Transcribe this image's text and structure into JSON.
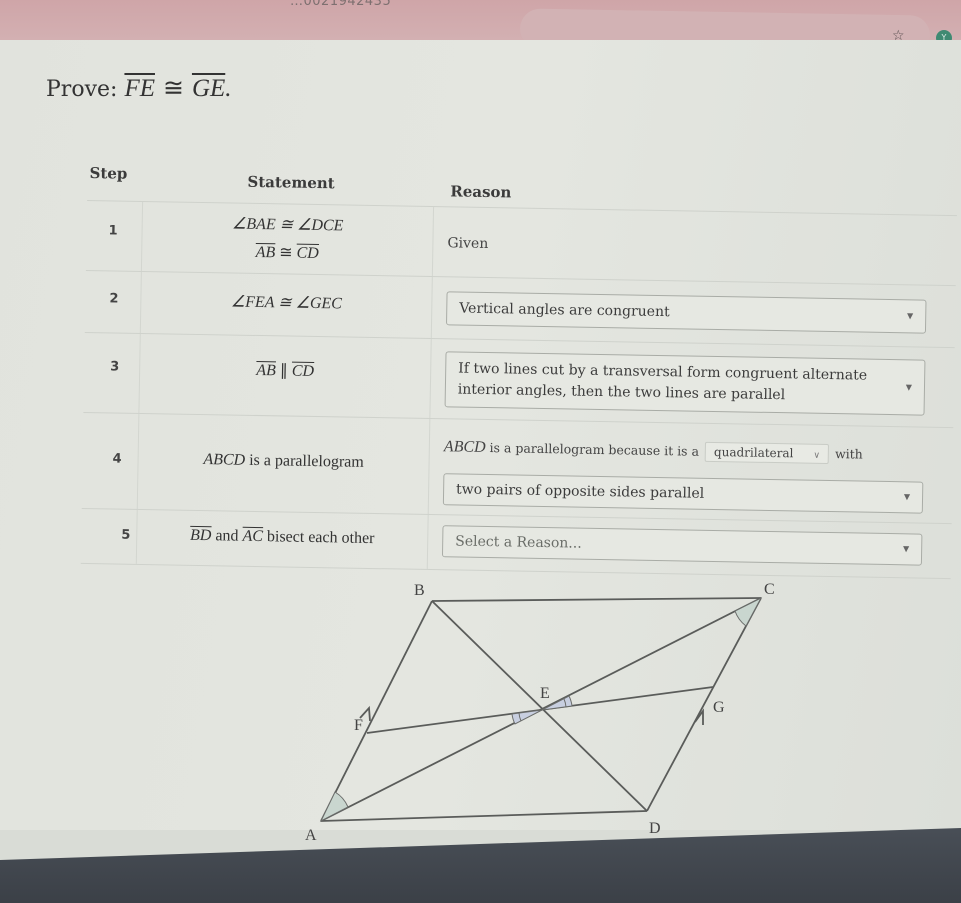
{
  "browser": {
    "url_fragment": "…0021942435",
    "star_icon": "☆",
    "profile_initial": "Y"
  },
  "prompt": {
    "prefix": "Prove:",
    "segment1": "FE",
    "congruent_symbol": "≅",
    "segment2": "GE",
    "suffix": "."
  },
  "table": {
    "headers": {
      "step": "Step",
      "statement": "Statement",
      "reason": "Reason"
    },
    "rows": [
      {
        "step": "1",
        "statement_line1": "∠BAE ≅ ∠DCE",
        "statement_line2_a": "AB",
        "statement_line2_op": " ≅ ",
        "statement_line2_b": "CD",
        "reason": "Given"
      },
      {
        "step": "2",
        "statement": "∠FEA ≅ ∠GEC",
        "reason": "Vertical angles are congruent"
      },
      {
        "step": "3",
        "statement_a": "AB",
        "statement_op": " ∥ ",
        "statement_b": "CD",
        "reason": "If two lines cut by a transversal form congruent alternate interior angles, then the two lines are parallel"
      },
      {
        "step": "4",
        "statement_math": "ABCD",
        "statement_text": " is a parallelogram",
        "reason_prefix_math": "ABCD",
        "reason_prefix_text": " is a parallelogram because it is a",
        "reason_inline_select": "quadrilateral",
        "reason_with": "with",
        "reason": "two pairs of opposite sides parallel"
      },
      {
        "step": "5",
        "statement_a": "BD",
        "statement_and": " and ",
        "statement_b": "AC",
        "statement_text": " bisect each other",
        "reason_placeholder": "Select a Reason..."
      }
    ]
  },
  "diagram": {
    "labels": {
      "A": "A",
      "B": "B",
      "C": "C",
      "D": "D",
      "E": "E",
      "F": "F",
      "G": "G"
    },
    "line_color": "#5a5c5a",
    "angle_fill_1": "#c9d6cf",
    "angle_fill_2": "#c8cfe0"
  }
}
